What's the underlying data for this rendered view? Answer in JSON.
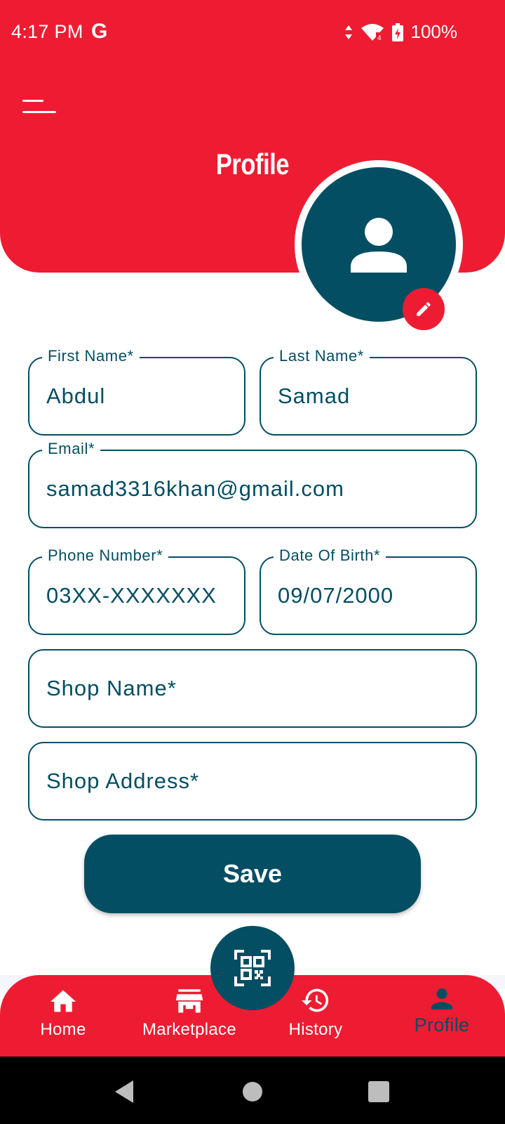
{
  "status_bar": {
    "time": "4:17 PM",
    "carrier_icon": "G",
    "battery": "100%",
    "icons": [
      "data-arrows-icon",
      "wifi-icon",
      "battery-charging-icon"
    ]
  },
  "header": {
    "title": "Profile",
    "menu_icon": "menu-icon"
  },
  "avatar": {
    "icon": "person-icon",
    "edit_icon": "pencil-icon"
  },
  "form": {
    "first_name": {
      "label": "First Name*",
      "value": "Abdul"
    },
    "last_name": {
      "label": "Last Name*",
      "value": "Samad"
    },
    "email": {
      "label": "Email*",
      "value": "samad3316khan@gmail.com"
    },
    "phone": {
      "label": "Phone Number*",
      "value": "03XX-XXXXXXX"
    },
    "dob": {
      "label": "Date Of Birth*",
      "value": "09/07/2000"
    },
    "shop_name": {
      "placeholder": "Shop Name*"
    },
    "shop_address": {
      "placeholder": "Shop Address*"
    },
    "save_label": "Save"
  },
  "bottom_nav": {
    "items": [
      {
        "label": "Home",
        "icon": "home-icon"
      },
      {
        "label": "Marketplace",
        "icon": "store-icon"
      },
      {
        "label": "History",
        "icon": "history-icon"
      },
      {
        "label": "Profile",
        "icon": "person-icon"
      }
    ],
    "active": "Profile",
    "center_icon": "qr-code-icon"
  },
  "colors": {
    "primary_red": "#ee1c32",
    "primary_teal": "#034e62",
    "background": "#ffffff"
  }
}
